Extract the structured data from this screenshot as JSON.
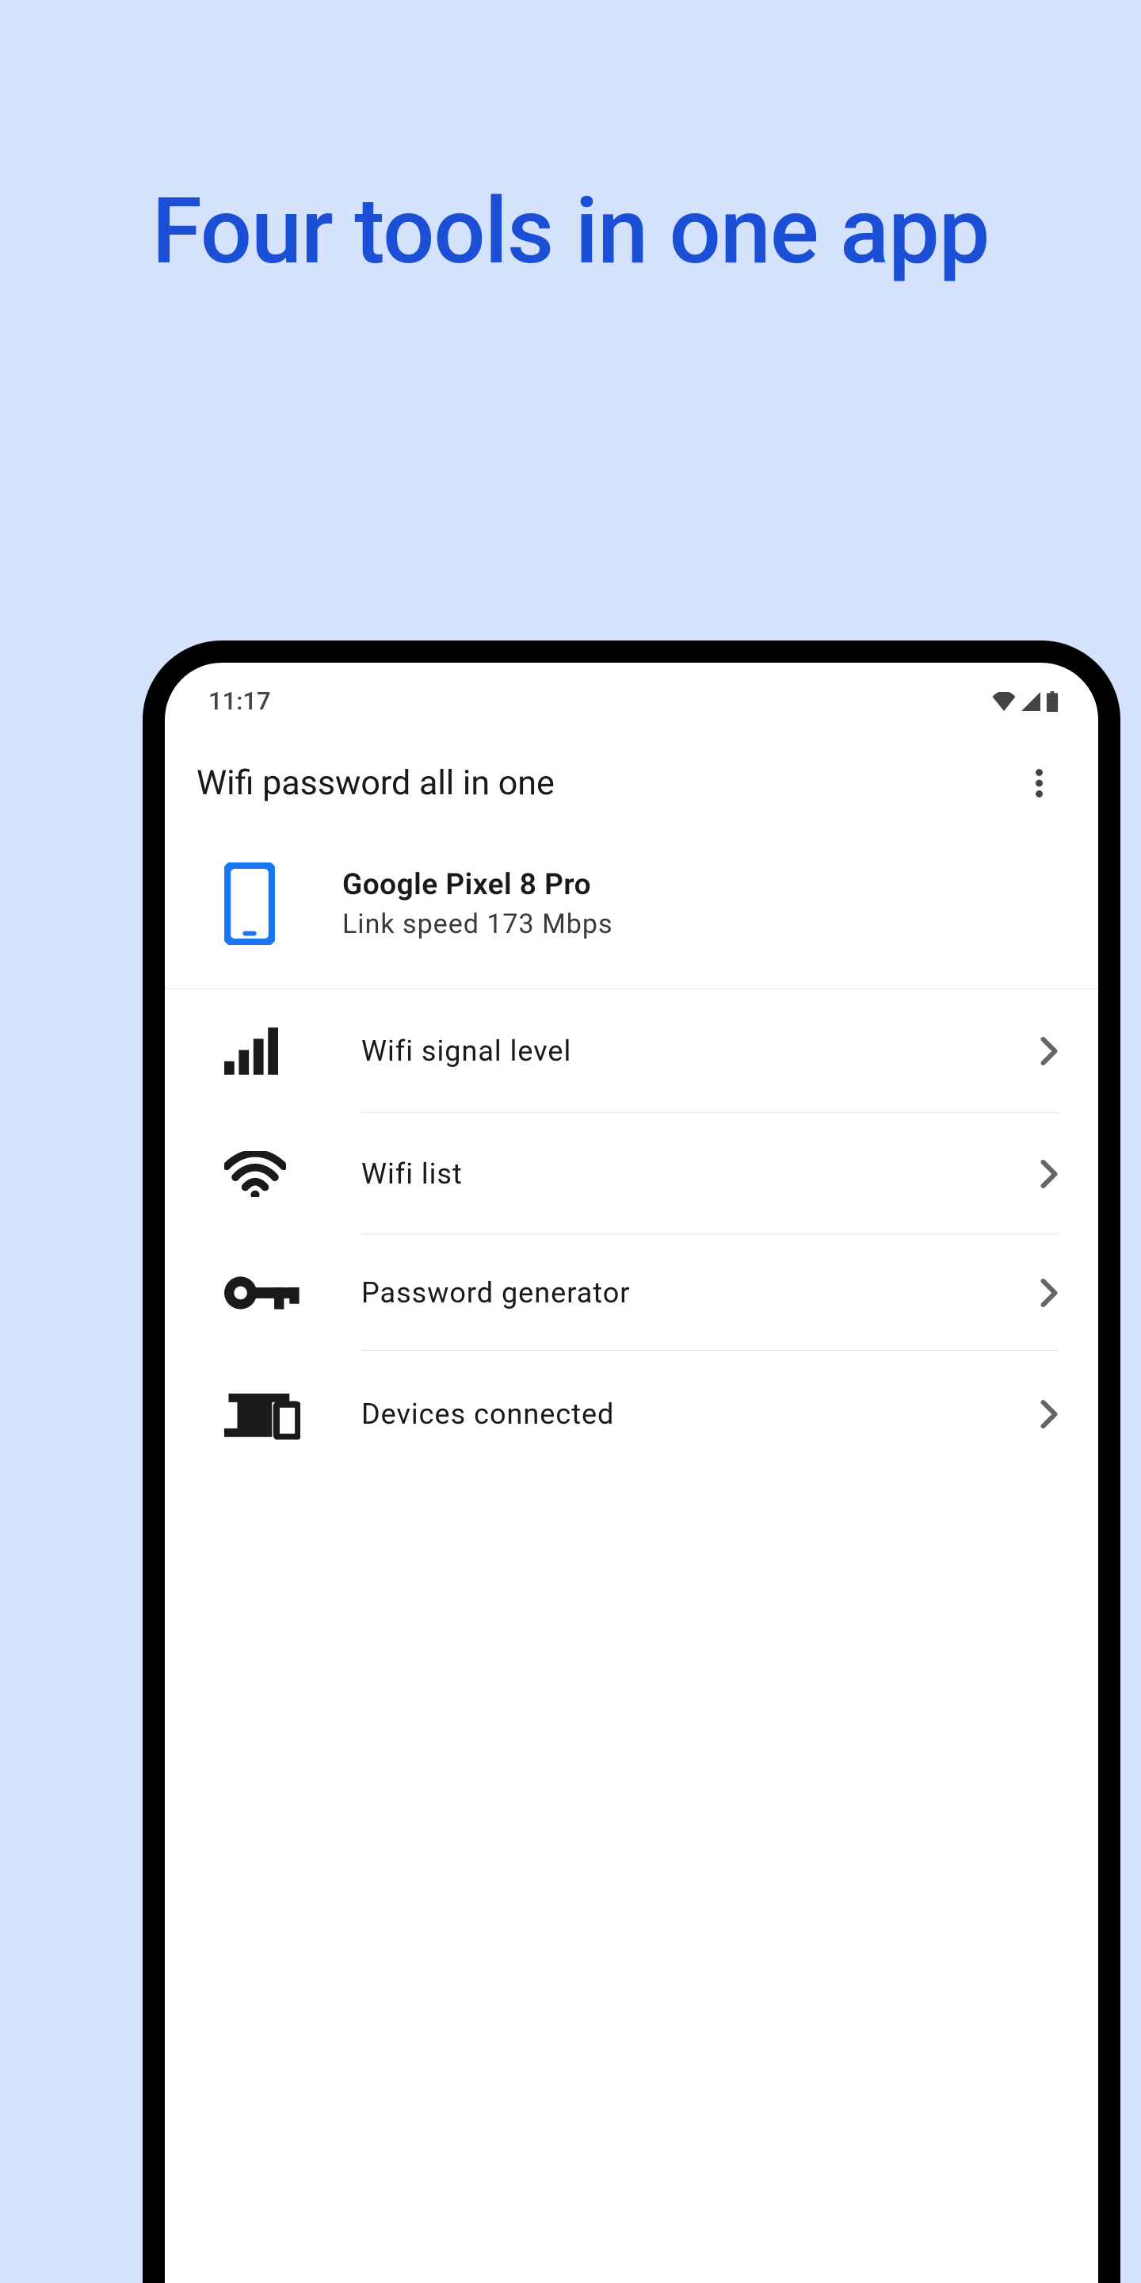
{
  "headline": "Four tools in one app",
  "status_bar": {
    "time": "11:17"
  },
  "app_bar": {
    "title": "Wifi password all in one"
  },
  "device": {
    "name": "Google Pixel 8 Pro",
    "subtitle": "Link speed 173 Mbps"
  },
  "menu": [
    {
      "label": "Wifi signal level",
      "icon": "signal-bars-icon"
    },
    {
      "label": "Wifi list",
      "icon": "wifi-icon"
    },
    {
      "label": "Password generator",
      "icon": "key-icon"
    },
    {
      "label": "Devices connected",
      "icon": "devices-icon"
    }
  ]
}
